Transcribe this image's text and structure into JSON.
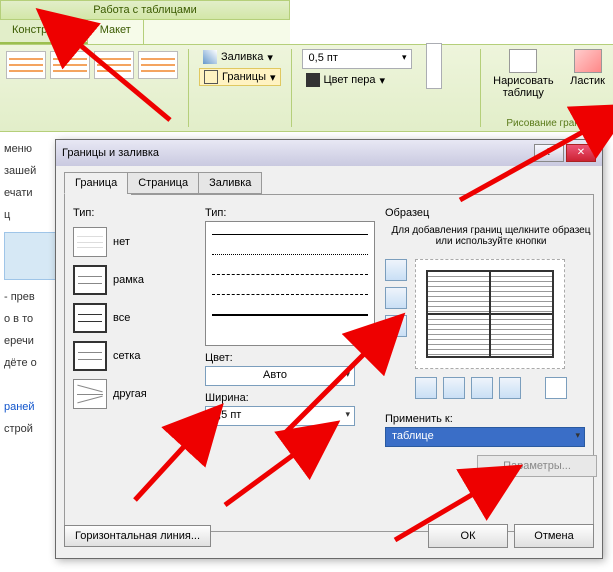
{
  "ribbon": {
    "title": "Работа с таблицами",
    "tabs": {
      "design": "Конструктор",
      "layout": "Макет"
    },
    "shading": "Заливка",
    "borders": "Границы",
    "weight": "0,5 пт",
    "pen_color": "Цвет пера",
    "draw_table": "Нарисовать таблицу",
    "eraser": "Ластик",
    "group_label": "Рисование границ"
  },
  "doc_fragments": [
    "меню",
    "зашей",
    "ечати",
    "ц",
    "- прев",
    "о в то",
    "еречи",
    "дёте о",
    "раней",
    "строй"
  ],
  "dialog": {
    "title": "Границы и заливка",
    "tabs": {
      "border": "Граница",
      "page": "Страница",
      "shading": "Заливка"
    },
    "type_label": "Тип:",
    "types": {
      "none": "нет",
      "box": "рамка",
      "all": "все",
      "grid": "сетка",
      "custom": "другая"
    },
    "style_label": "Тип:",
    "color_label": "Цвет:",
    "color_value": "Авто",
    "width_label": "Ширина:",
    "width_value": "0,5 пт",
    "preview_label": "Образец",
    "preview_hint": "Для добавления границ щелкните образец или используйте кнопки",
    "apply_label": "Применить к:",
    "apply_value": "таблице",
    "params": "Параметры...",
    "hline": "Горизонтальная линия...",
    "ok": "ОК",
    "cancel": "Отмена"
  }
}
